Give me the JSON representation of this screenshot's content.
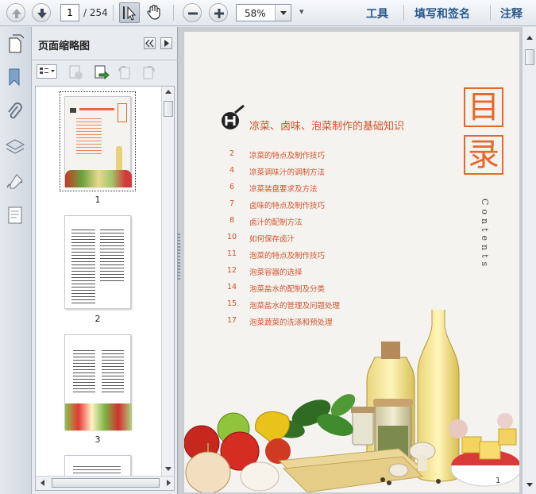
{
  "toolbar": {
    "page_current": "1",
    "page_total": "/ 254",
    "zoom": "58%",
    "menu_more": "▾",
    "tools_label": "工具",
    "sign_label": "填写和签名",
    "comment_label": "注释"
  },
  "panel": {
    "title": "页面缩略图",
    "thumbnails": [
      {
        "label": "1"
      },
      {
        "label": "2"
      },
      {
        "label": "3"
      }
    ]
  },
  "document": {
    "heading": "凉菜、卤味、泡菜制作的基础知识",
    "side_title_1": "目",
    "side_title_2": "录",
    "side_english": "Contents",
    "page_number": "1",
    "toc": [
      {
        "num": "2",
        "title": "凉菜的特点及制作技巧"
      },
      {
        "num": "4",
        "title": "凉菜调味汁的调制方法"
      },
      {
        "num": "6",
        "title": "凉菜装盘要求及方法"
      },
      {
        "num": "7",
        "title": "卤味的特点及制作技巧"
      },
      {
        "num": "8",
        "title": "卤汁的配制方法"
      },
      {
        "num": "10",
        "title": "如何保存卤汁"
      },
      {
        "num": "11",
        "title": "泡菜的特点及制作技巧"
      },
      {
        "num": "12",
        "title": "泡菜容器的选择"
      },
      {
        "num": "14",
        "title": "泡菜盐水的配制及分类"
      },
      {
        "num": "15",
        "title": "泡菜盐水的管理及问题处理"
      },
      {
        "num": "17",
        "title": "泡菜蔬菜的洗涤和预处理"
      }
    ]
  },
  "colors": {
    "accent": "#d4502a",
    "link": "#2a5a8c"
  }
}
